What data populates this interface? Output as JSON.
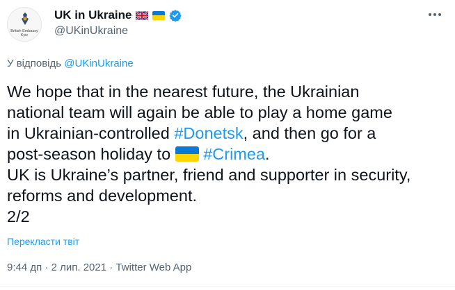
{
  "account": {
    "name": "UK in Ukraine",
    "handle": "@UKinUkraine",
    "avatar_text": "British Embassy Kyiv",
    "verified": true
  },
  "reply_context": {
    "prefix": "У відповідь",
    "mention": "@UKinUkraine"
  },
  "tweet": {
    "line1": "We hope that in the nearest future, the Ukrainian",
    "line2": "national team will again be able to play a home game",
    "line3_pre": "in Ukrainian-controlled ",
    "hashtag1": "#Donetsk",
    "line3_post": ", and then go for a",
    "line4_pre": "post-season holiday to ",
    "hashtag2": "#Crimea",
    "line4_post": ".",
    "line5": "UK is Ukraine’s partner, friend and supporter in security,",
    "line6": "reforms and development.",
    "line7": "2/2"
  },
  "translate_label": "Перекласти твіт",
  "meta": {
    "time": "9:44 дп",
    "date": "2 лип. 2021",
    "source": "Twitter Web App",
    "separator": "·"
  },
  "colors": {
    "link": "#1d9bf0",
    "text": "#0f1419",
    "secondary": "#536471",
    "ua_blue": "#0a7ad6",
    "ua_yellow": "#ffd500"
  },
  "icons": [
    "uk-flag-icon",
    "ukraine-flag-icon",
    "verified-badge-icon",
    "more-icon"
  ]
}
